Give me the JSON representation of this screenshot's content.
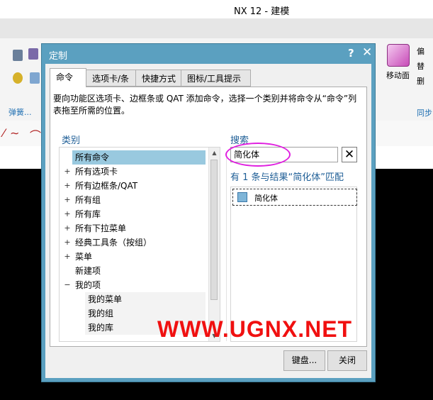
{
  "app": {
    "title": "NX 12 - 建模"
  },
  "ribbon": {
    "group_left": "弹簧...",
    "move_face": "移动面",
    "group_right": "同步",
    "right_icon_labels": [
      "偏",
      "替",
      "删"
    ]
  },
  "dialog": {
    "title": "定制",
    "help": "?",
    "close": "✕",
    "tabs": [
      "命令",
      "选项卡/条",
      "快捷方式",
      "图标/工具提示"
    ],
    "description": "要向功能区选项卡、边框条或 QAT 添加命令，选择一个类别并将命令从“命令”列表拖至所需的位置。",
    "category_label": "类别",
    "categories": [
      {
        "label": "所有命令",
        "expander": "",
        "selected": true
      },
      {
        "label": "所有选项卡",
        "expander": "+"
      },
      {
        "label": "所有边框条/QAT",
        "expander": "+"
      },
      {
        "label": "所有组",
        "expander": "+"
      },
      {
        "label": "所有库",
        "expander": "+"
      },
      {
        "label": "所有下拉菜单",
        "expander": "+"
      },
      {
        "label": "经典工具条（按组）",
        "expander": "+"
      },
      {
        "label": "菜单",
        "expander": "+"
      },
      {
        "label": "新建项",
        "expander": ""
      },
      {
        "label": "我的项",
        "expander": "−"
      },
      {
        "label": "我的菜单",
        "expander": "",
        "child": true
      },
      {
        "label": "我的组",
        "expander": "",
        "child": true
      },
      {
        "label": "我的库",
        "expander": "",
        "child": true
      }
    ],
    "search_label": "搜索",
    "search_value": "简化体",
    "search_clear": "✕",
    "results_label": "有 1 条与结果“简化体”匹配",
    "results": [
      "简化体"
    ],
    "buttons": {
      "keyboard": "键盘...",
      "close": "关闭"
    }
  },
  "watermark": "WWW.UGNX.NET",
  "colors": {
    "titlebar": "#5ba0c0",
    "selection": "#99c9df",
    "accent_text": "#1e5e96",
    "highlight_ring": "#e020e0",
    "watermark": "#f01010"
  }
}
